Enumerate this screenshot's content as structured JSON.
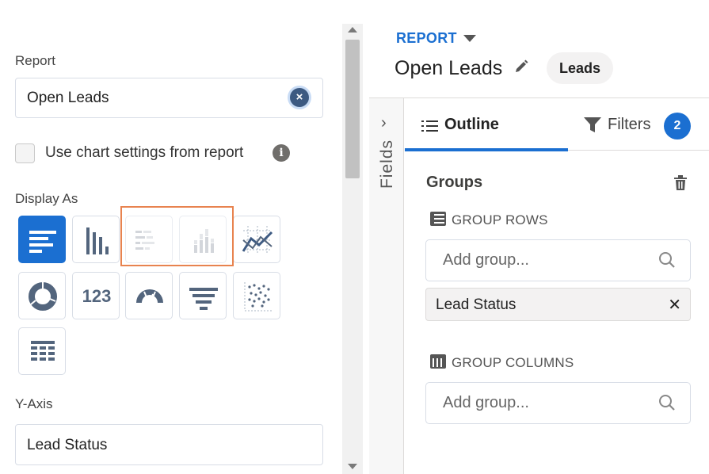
{
  "report_field": {
    "label": "Report",
    "value": "Open Leads"
  },
  "chart_settings": {
    "label": "Use chart settings from report",
    "checked": false
  },
  "display_as": {
    "label": "Display As",
    "options": [
      {
        "name": "horizontal-bar-chart",
        "selected": true
      },
      {
        "name": "vertical-bar-chart",
        "selected": false
      },
      {
        "name": "stacked-horizontal-bar-chart",
        "selected": false,
        "disabled": true
      },
      {
        "name": "stacked-vertical-bar-chart",
        "selected": false,
        "disabled": true
      },
      {
        "name": "line-chart",
        "selected": false
      },
      {
        "name": "donut-chart",
        "selected": false
      },
      {
        "name": "metric",
        "text": "123",
        "selected": false
      },
      {
        "name": "gauge-chart",
        "selected": false
      },
      {
        "name": "funnel-chart",
        "selected": false
      },
      {
        "name": "scatter-chart",
        "selected": false
      },
      {
        "name": "table",
        "selected": false
      }
    ]
  },
  "y_axis": {
    "label": "Y-Axis",
    "value": "Lead Status"
  },
  "report_header": {
    "menu_label": "REPORT",
    "title": "Open Leads",
    "report_type": "Leads"
  },
  "fields_panel": {
    "label": "Fields"
  },
  "tabs": {
    "outline": {
      "label": "Outline",
      "active": true
    },
    "filters": {
      "label": "Filters",
      "count": "2"
    }
  },
  "groups": {
    "title": "Groups",
    "rows": {
      "label": "GROUP ROWS",
      "placeholder": "Add group...",
      "items": [
        "Lead Status"
      ]
    },
    "columns": {
      "label": "GROUP COLUMNS",
      "placeholder": "Add group..."
    }
  },
  "colors": {
    "accent": "#1b6fd1",
    "highlight": "#e8834f"
  }
}
